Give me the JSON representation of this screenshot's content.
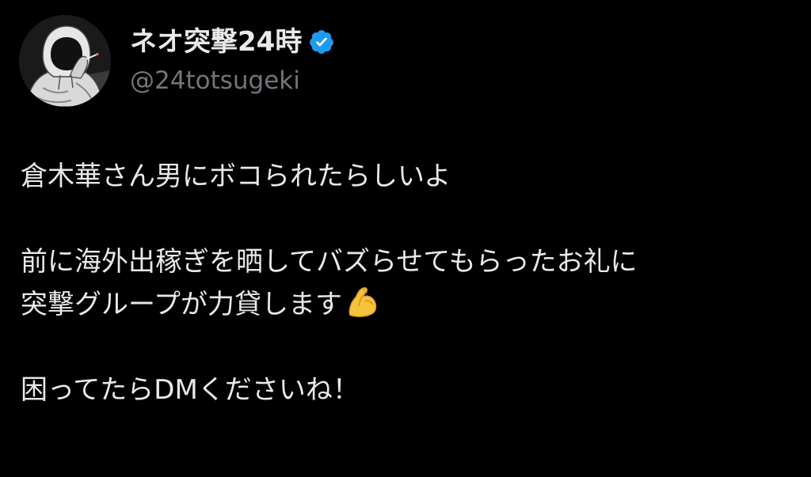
{
  "author": {
    "display_name": "ネオ突撃24時",
    "handle": "@24totsugeki",
    "verified": true
  },
  "tweet": {
    "paragraphs": [
      {
        "lines": [
          "倉木華さん男にボコられたらしいよ"
        ]
      },
      {
        "lines": [
          "前に海外出稼ぎを晒してバズらせてもらったお礼に",
          "突撃グループが力貸します"
        ],
        "trailing_emoji": "flexed-biceps-icon"
      },
      {
        "lines": [
          "困ってたらDMくださいね！"
        ]
      }
    ]
  },
  "colors": {
    "background": "#000000",
    "text": "#e7e9ea",
    "secondary_text": "#71767b",
    "verified_badge": "#1d9bf0"
  }
}
